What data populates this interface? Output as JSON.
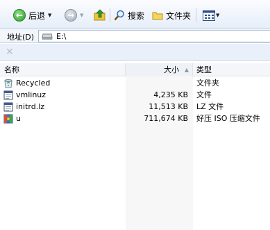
{
  "toolbar": {
    "back_label": "后退",
    "search_label": "搜索",
    "folders_label": "文件夹"
  },
  "address": {
    "label": "地址(D)",
    "value": "E:\\"
  },
  "columns": {
    "name": "名称",
    "size": "大小",
    "type": "类型"
  },
  "files": [
    {
      "name": "Recycled",
      "size": "",
      "type": "文件夹",
      "icon": "recycle-bin-icon"
    },
    {
      "name": "vmlinuz",
      "size": "4,235 KB",
      "type": "文件",
      "icon": "generic-file-icon"
    },
    {
      "name": "initrd.lz",
      "size": "11,513 KB",
      "type": "LZ 文件",
      "icon": "generic-file-icon"
    },
    {
      "name": "u",
      "size": "711,674 KB",
      "type": "好压 ISO 压缩文件",
      "icon": "archive-icon"
    }
  ]
}
